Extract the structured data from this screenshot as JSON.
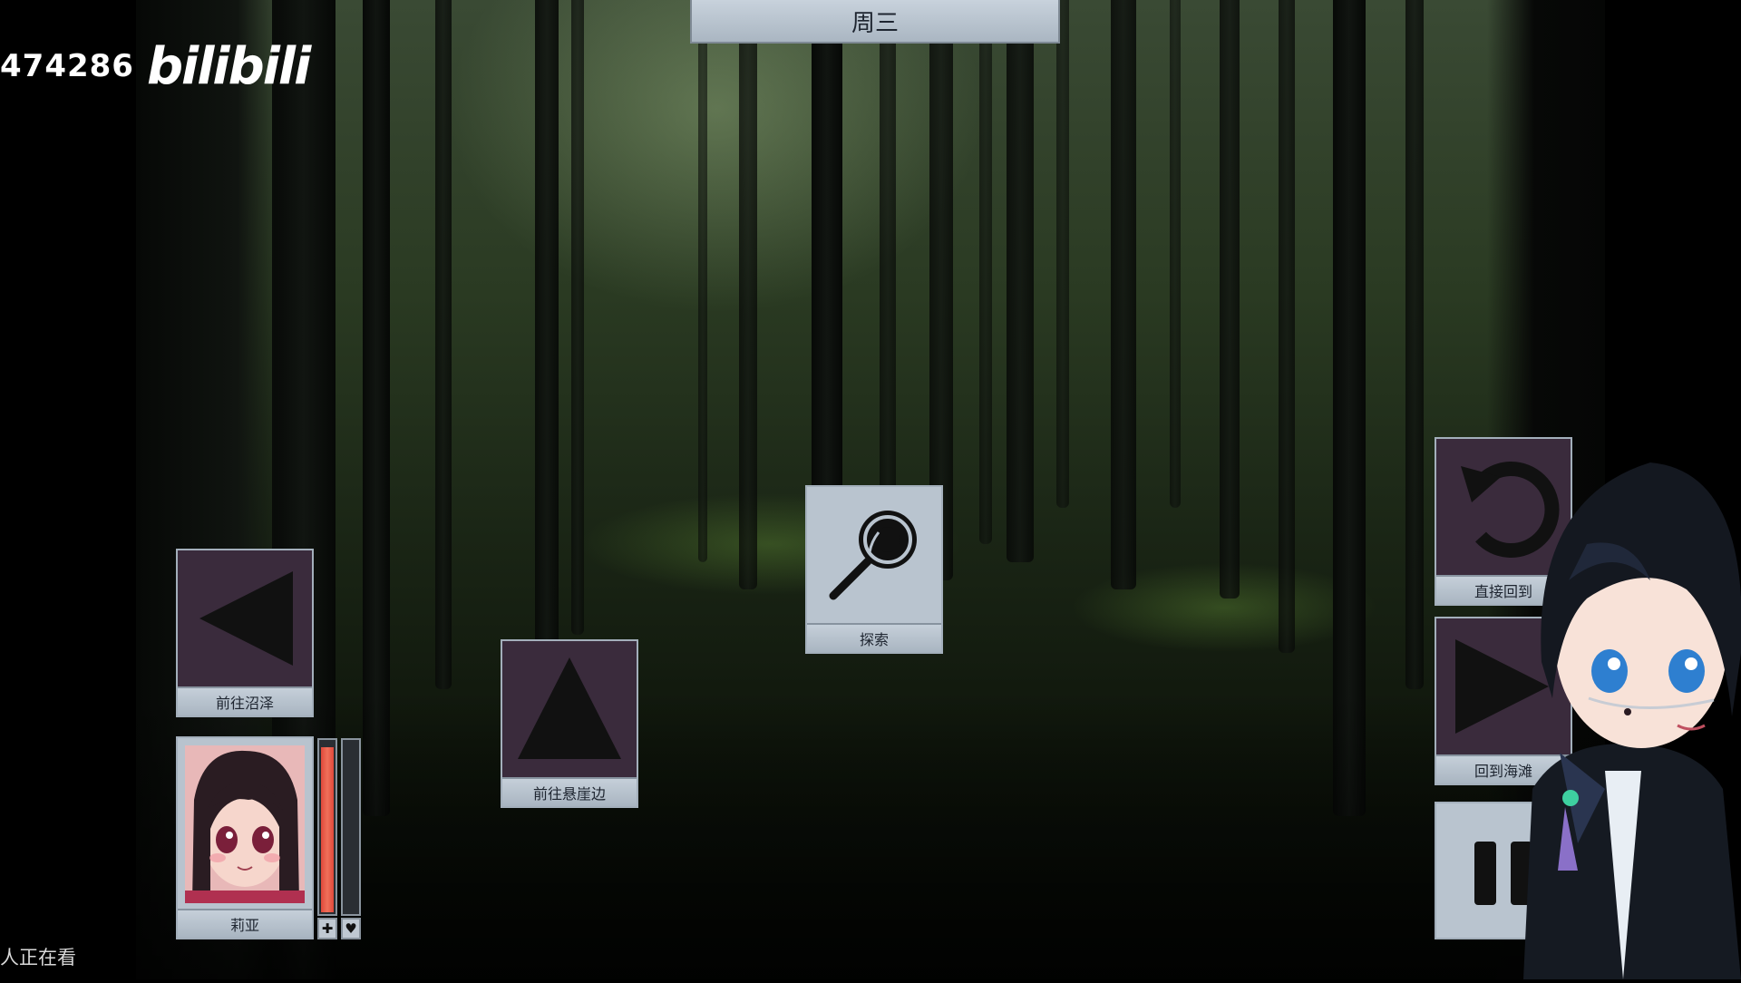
{
  "overlay": {
    "stream_id": "474286",
    "brand": "bilibili",
    "viewer_text": "人正在看"
  },
  "hud": {
    "day": "周三"
  },
  "actions": {
    "explore": {
      "label": "探索",
      "icon": "magnifier-icon"
    },
    "to_swamp": {
      "label": "前往沼泽",
      "icon": "arrow-left-icon"
    },
    "to_cliff": {
      "label": "前往悬崖边",
      "icon": "arrow-up-icon"
    },
    "return_direct": {
      "label": "直接回到",
      "icon": "rotate-back-icon"
    },
    "to_beach": {
      "label": "回到海滩",
      "icon": "arrow-right-icon"
    },
    "pause": {
      "icon": "pause-icon"
    }
  },
  "character": {
    "name": "莉亚",
    "health_fraction": 0.97,
    "affection_fraction": 0.0,
    "health_icon": "plus-icon",
    "affection_icon": "heart-icon",
    "colors": {
      "health": "#e0483a",
      "affection": "#e07080"
    }
  },
  "colors": {
    "button_face_purple": "#3a2b3c",
    "button_frame": "#b8c3ce"
  }
}
